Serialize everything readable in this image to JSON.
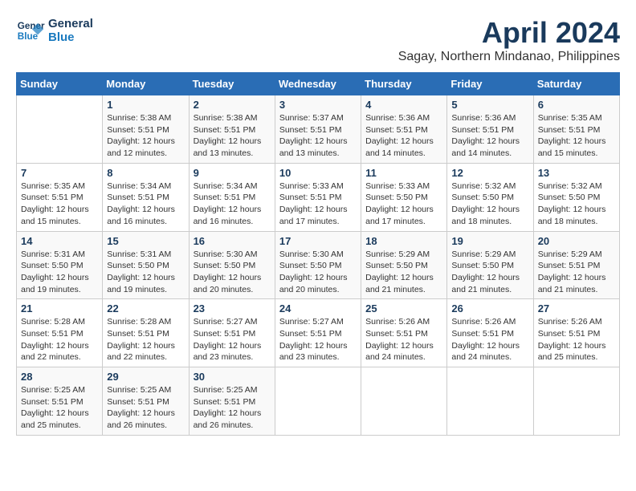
{
  "logo": {
    "line1": "General",
    "line2": "Blue"
  },
  "title": "April 2024",
  "subtitle": "Sagay, Northern Mindanao, Philippines",
  "weekdays": [
    "Sunday",
    "Monday",
    "Tuesday",
    "Wednesday",
    "Thursday",
    "Friday",
    "Saturday"
  ],
  "weeks": [
    [
      {
        "day": "",
        "sunrise": "",
        "sunset": "",
        "daylight": ""
      },
      {
        "day": "1",
        "sunrise": "Sunrise: 5:38 AM",
        "sunset": "Sunset: 5:51 PM",
        "daylight": "Daylight: 12 hours and 12 minutes."
      },
      {
        "day": "2",
        "sunrise": "Sunrise: 5:38 AM",
        "sunset": "Sunset: 5:51 PM",
        "daylight": "Daylight: 12 hours and 13 minutes."
      },
      {
        "day": "3",
        "sunrise": "Sunrise: 5:37 AM",
        "sunset": "Sunset: 5:51 PM",
        "daylight": "Daylight: 12 hours and 13 minutes."
      },
      {
        "day": "4",
        "sunrise": "Sunrise: 5:36 AM",
        "sunset": "Sunset: 5:51 PM",
        "daylight": "Daylight: 12 hours and 14 minutes."
      },
      {
        "day": "5",
        "sunrise": "Sunrise: 5:36 AM",
        "sunset": "Sunset: 5:51 PM",
        "daylight": "Daylight: 12 hours and 14 minutes."
      },
      {
        "day": "6",
        "sunrise": "Sunrise: 5:35 AM",
        "sunset": "Sunset: 5:51 PM",
        "daylight": "Daylight: 12 hours and 15 minutes."
      }
    ],
    [
      {
        "day": "7",
        "sunrise": "Sunrise: 5:35 AM",
        "sunset": "Sunset: 5:51 PM",
        "daylight": "Daylight: 12 hours and 15 minutes."
      },
      {
        "day": "8",
        "sunrise": "Sunrise: 5:34 AM",
        "sunset": "Sunset: 5:51 PM",
        "daylight": "Daylight: 12 hours and 16 minutes."
      },
      {
        "day": "9",
        "sunrise": "Sunrise: 5:34 AM",
        "sunset": "Sunset: 5:51 PM",
        "daylight": "Daylight: 12 hours and 16 minutes."
      },
      {
        "day": "10",
        "sunrise": "Sunrise: 5:33 AM",
        "sunset": "Sunset: 5:51 PM",
        "daylight": "Daylight: 12 hours and 17 minutes."
      },
      {
        "day": "11",
        "sunrise": "Sunrise: 5:33 AM",
        "sunset": "Sunset: 5:50 PM",
        "daylight": "Daylight: 12 hours and 17 minutes."
      },
      {
        "day": "12",
        "sunrise": "Sunrise: 5:32 AM",
        "sunset": "Sunset: 5:50 PM",
        "daylight": "Daylight: 12 hours and 18 minutes."
      },
      {
        "day": "13",
        "sunrise": "Sunrise: 5:32 AM",
        "sunset": "Sunset: 5:50 PM",
        "daylight": "Daylight: 12 hours and 18 minutes."
      }
    ],
    [
      {
        "day": "14",
        "sunrise": "Sunrise: 5:31 AM",
        "sunset": "Sunset: 5:50 PM",
        "daylight": "Daylight: 12 hours and 19 minutes."
      },
      {
        "day": "15",
        "sunrise": "Sunrise: 5:31 AM",
        "sunset": "Sunset: 5:50 PM",
        "daylight": "Daylight: 12 hours and 19 minutes."
      },
      {
        "day": "16",
        "sunrise": "Sunrise: 5:30 AM",
        "sunset": "Sunset: 5:50 PM",
        "daylight": "Daylight: 12 hours and 20 minutes."
      },
      {
        "day": "17",
        "sunrise": "Sunrise: 5:30 AM",
        "sunset": "Sunset: 5:50 PM",
        "daylight": "Daylight: 12 hours and 20 minutes."
      },
      {
        "day": "18",
        "sunrise": "Sunrise: 5:29 AM",
        "sunset": "Sunset: 5:50 PM",
        "daylight": "Daylight: 12 hours and 21 minutes."
      },
      {
        "day": "19",
        "sunrise": "Sunrise: 5:29 AM",
        "sunset": "Sunset: 5:50 PM",
        "daylight": "Daylight: 12 hours and 21 minutes."
      },
      {
        "day": "20",
        "sunrise": "Sunrise: 5:29 AM",
        "sunset": "Sunset: 5:51 PM",
        "daylight": "Daylight: 12 hours and 21 minutes."
      }
    ],
    [
      {
        "day": "21",
        "sunrise": "Sunrise: 5:28 AM",
        "sunset": "Sunset: 5:51 PM",
        "daylight": "Daylight: 12 hours and 22 minutes."
      },
      {
        "day": "22",
        "sunrise": "Sunrise: 5:28 AM",
        "sunset": "Sunset: 5:51 PM",
        "daylight": "Daylight: 12 hours and 22 minutes."
      },
      {
        "day": "23",
        "sunrise": "Sunrise: 5:27 AM",
        "sunset": "Sunset: 5:51 PM",
        "daylight": "Daylight: 12 hours and 23 minutes."
      },
      {
        "day": "24",
        "sunrise": "Sunrise: 5:27 AM",
        "sunset": "Sunset: 5:51 PM",
        "daylight": "Daylight: 12 hours and 23 minutes."
      },
      {
        "day": "25",
        "sunrise": "Sunrise: 5:26 AM",
        "sunset": "Sunset: 5:51 PM",
        "daylight": "Daylight: 12 hours and 24 minutes."
      },
      {
        "day": "26",
        "sunrise": "Sunrise: 5:26 AM",
        "sunset": "Sunset: 5:51 PM",
        "daylight": "Daylight: 12 hours and 24 minutes."
      },
      {
        "day": "27",
        "sunrise": "Sunrise: 5:26 AM",
        "sunset": "Sunset: 5:51 PM",
        "daylight": "Daylight: 12 hours and 25 minutes."
      }
    ],
    [
      {
        "day": "28",
        "sunrise": "Sunrise: 5:25 AM",
        "sunset": "Sunset: 5:51 PM",
        "daylight": "Daylight: 12 hours and 25 minutes."
      },
      {
        "day": "29",
        "sunrise": "Sunrise: 5:25 AM",
        "sunset": "Sunset: 5:51 PM",
        "daylight": "Daylight: 12 hours and 26 minutes."
      },
      {
        "day": "30",
        "sunrise": "Sunrise: 5:25 AM",
        "sunset": "Sunset: 5:51 PM",
        "daylight": "Daylight: 12 hours and 26 minutes."
      },
      {
        "day": "",
        "sunrise": "",
        "sunset": "",
        "daylight": ""
      },
      {
        "day": "",
        "sunrise": "",
        "sunset": "",
        "daylight": ""
      },
      {
        "day": "",
        "sunrise": "",
        "sunset": "",
        "daylight": ""
      },
      {
        "day": "",
        "sunrise": "",
        "sunset": "",
        "daylight": ""
      }
    ]
  ]
}
